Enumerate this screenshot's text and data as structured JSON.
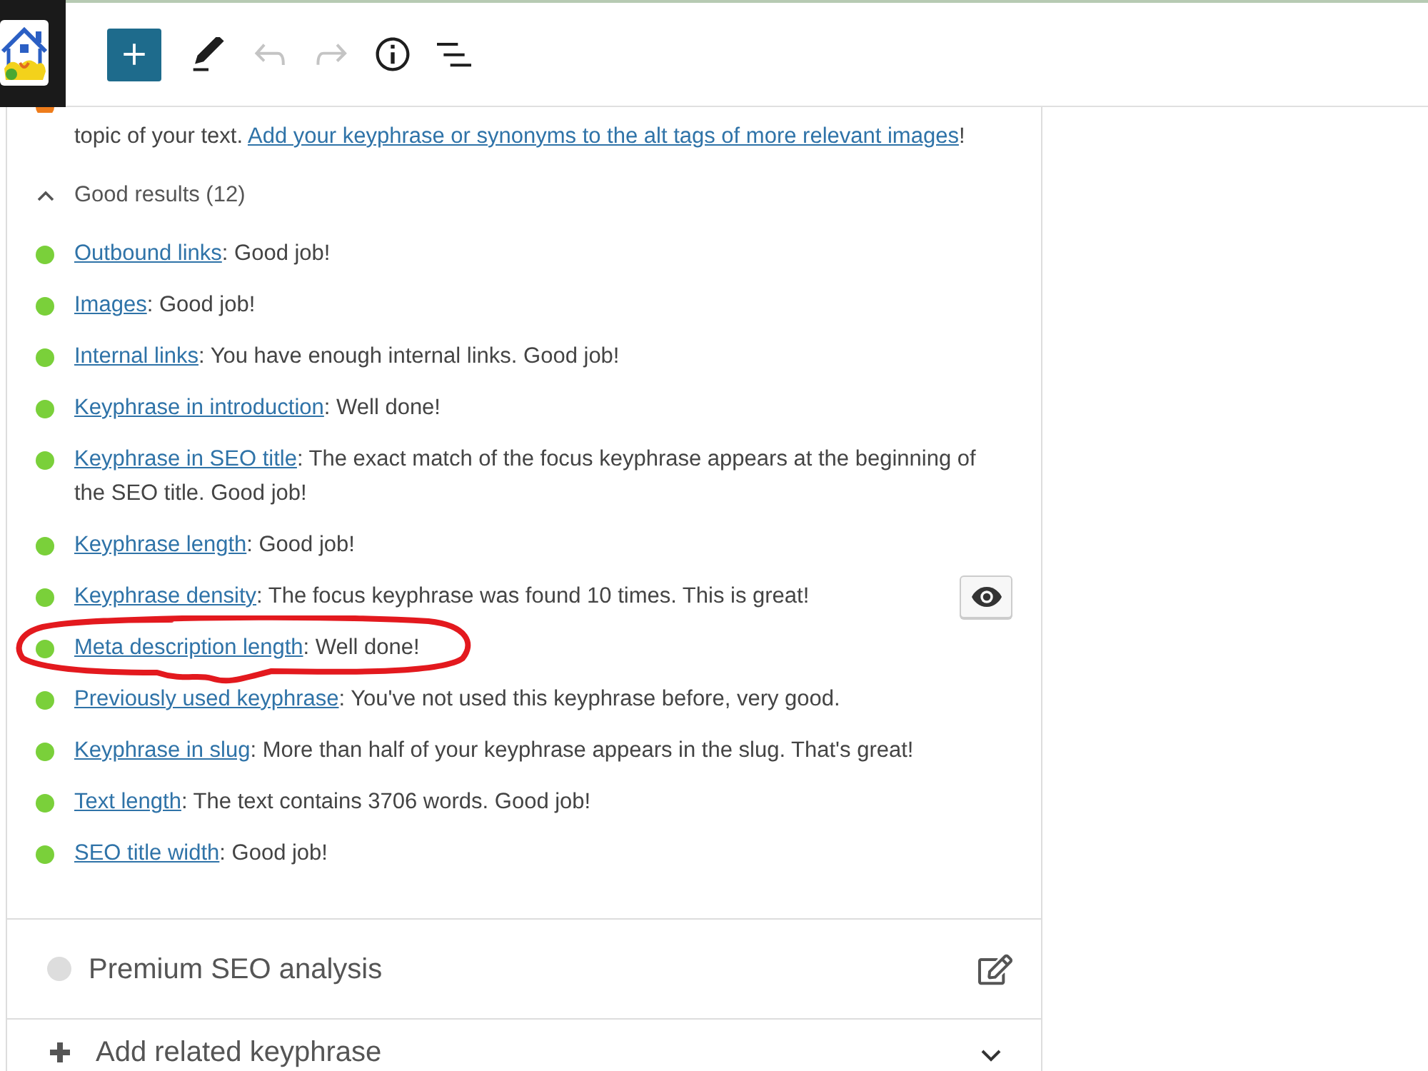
{
  "toolbar": {
    "buttons": [
      {
        "kind": "add",
        "disabled": false
      },
      {
        "kind": "edit",
        "disabled": false
      },
      {
        "kind": "undo",
        "disabled": true
      },
      {
        "kind": "redo",
        "disabled": true
      },
      {
        "kind": "details",
        "disabled": false
      },
      {
        "kind": "outline",
        "disabled": false
      }
    ]
  },
  "seo_analysis": {
    "cut_item": {
      "color": "#ee7c1b",
      "text": "topic of your text. ",
      "link": "Add your keyphrase or synonyms to the alt tags of more relevant images",
      "after": "!"
    },
    "good_results": {
      "label": "Good results (12)",
      "expanded": true,
      "items": [
        {
          "link": "Outbound links",
          "text": ": Good job!",
          "color": "#7ad03a",
          "marker_button": false,
          "circled": false
        },
        {
          "link": "Images",
          "text": ": Good job!",
          "color": "#7ad03a",
          "marker_button": false,
          "circled": false
        },
        {
          "link": "Internal links",
          "text": ": You have enough internal links. Good job!",
          "color": "#7ad03a",
          "marker_button": false,
          "circled": false
        },
        {
          "link": "Keyphrase in introduction",
          "text": ": Well done!",
          "color": "#7ad03a",
          "marker_button": false,
          "circled": false
        },
        {
          "link": "Keyphrase in SEO title",
          "text": ": The exact match of the focus keyphrase appears at the beginning of the SEO title. Good job!",
          "color": "#7ad03a",
          "marker_button": false,
          "circled": false
        },
        {
          "link": "Keyphrase length",
          "text": ": Good job!",
          "color": "#7ad03a",
          "marker_button": false,
          "circled": false
        },
        {
          "link": "Keyphrase density",
          "text": ": The focus keyphrase was found 10 times. This is great!",
          "color": "#7ad03a",
          "marker_button": true,
          "circled": false
        },
        {
          "link": "Meta description length",
          "text": ": Well done!",
          "color": "#7ad03a",
          "marker_button": false,
          "circled": true
        },
        {
          "link": "Previously used keyphrase",
          "text": ": You've not used this keyphrase before, very good.",
          "color": "#7ad03a",
          "marker_button": false,
          "circled": false
        },
        {
          "link": "Keyphrase in slug",
          "text": ": More than half of your keyphrase appears in the slug. That's great!",
          "color": "#7ad03a",
          "marker_button": false,
          "circled": false
        },
        {
          "link": "Text length",
          "text": ": The text contains 3706 words. Good job!",
          "color": "#7ad03a",
          "marker_button": false,
          "circled": false
        },
        {
          "link": "SEO title width",
          "text": ": Good job!",
          "color": "#7ad03a",
          "marker_button": false,
          "circled": false
        }
      ]
    }
  },
  "sections": [
    {
      "kind": "premium",
      "label": "Premium SEO analysis"
    },
    {
      "kind": "related",
      "label": "Add related keyphrase"
    }
  ]
}
